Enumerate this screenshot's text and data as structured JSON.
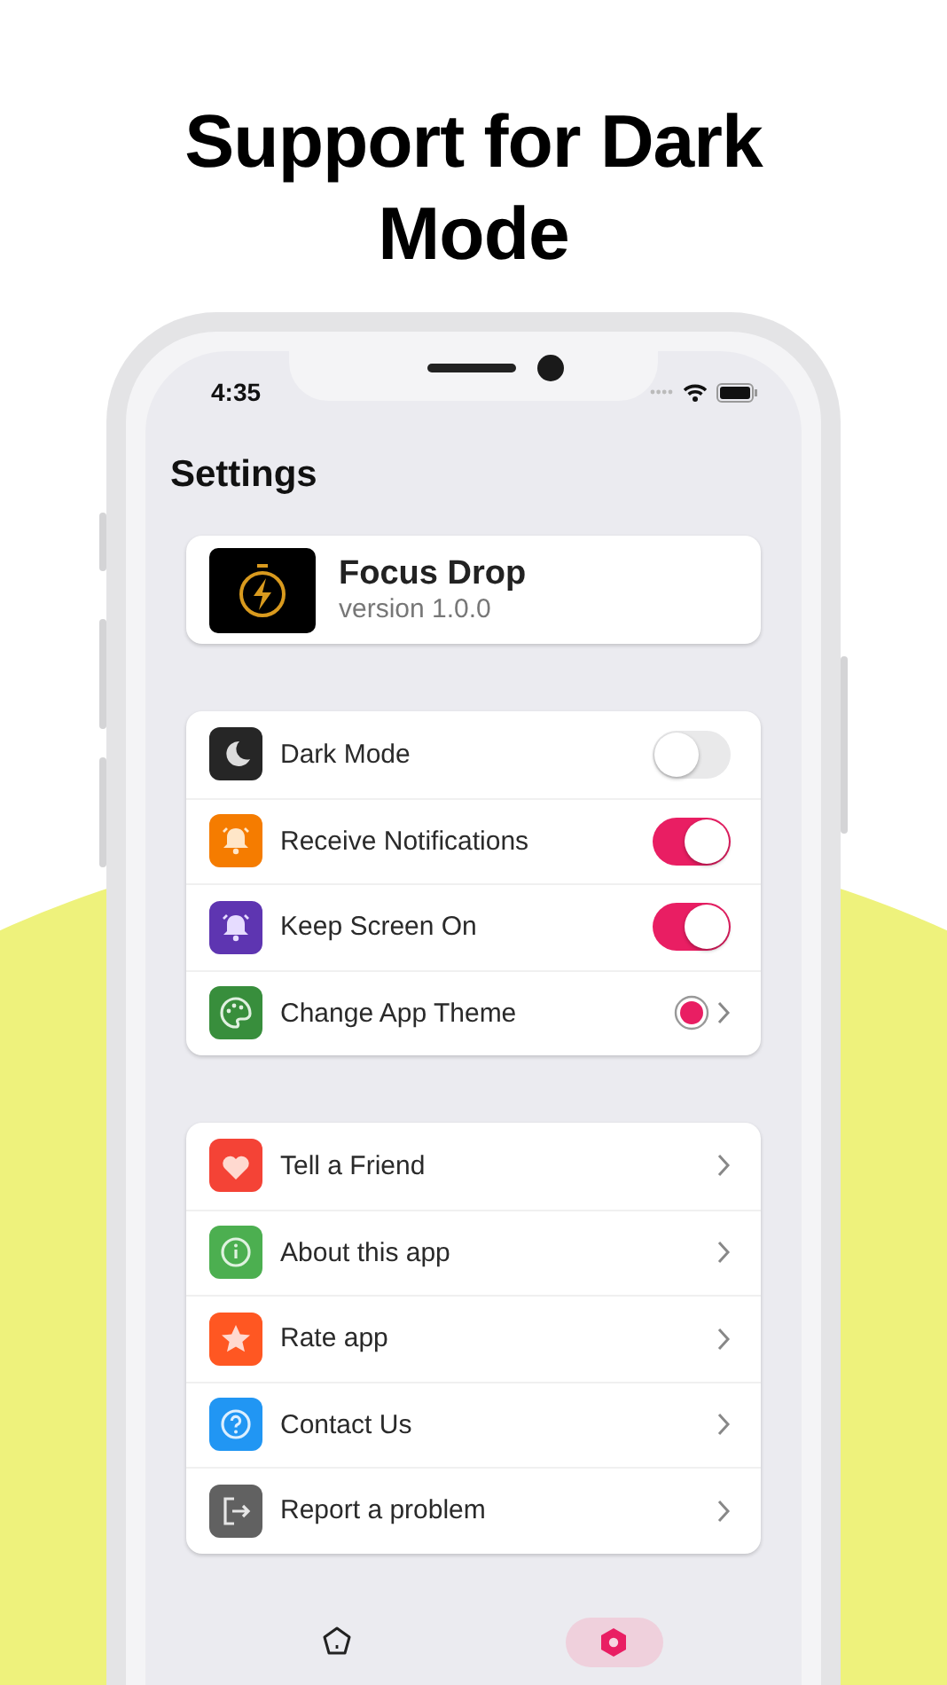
{
  "headline": "Support for Dark Mode",
  "status_bar": {
    "time": "4:35"
  },
  "page_title": "Settings",
  "app_card": {
    "name": "Focus Drop",
    "version": "version 1.0.0"
  },
  "preferences": [
    {
      "kind": "toggle",
      "label": "Dark Mode",
      "color": "#262626",
      "on": false
    },
    {
      "kind": "toggle",
      "label": "Receive Notifications",
      "color": "#f57c00",
      "on": true
    },
    {
      "kind": "toggle",
      "label": "Keep Screen On",
      "color": "#5e35b1",
      "on": true
    },
    {
      "kind": "theme",
      "label": "Change App Theme",
      "color": "#388e3c",
      "theme": {
        "color": "#e91e63"
      }
    }
  ],
  "links": [
    {
      "label": "Tell a Friend",
      "color": "#f44336"
    },
    {
      "label": "About this app",
      "color": "#4caf50"
    },
    {
      "label": "Rate app",
      "color": "#ff5722"
    },
    {
      "label": "Contact Us",
      "color": "#2196f3"
    },
    {
      "label": "Report a problem",
      "color": "#616161"
    }
  ],
  "bottom_nav": [
    {
      "selected": false
    },
    {
      "selected": true
    }
  ]
}
